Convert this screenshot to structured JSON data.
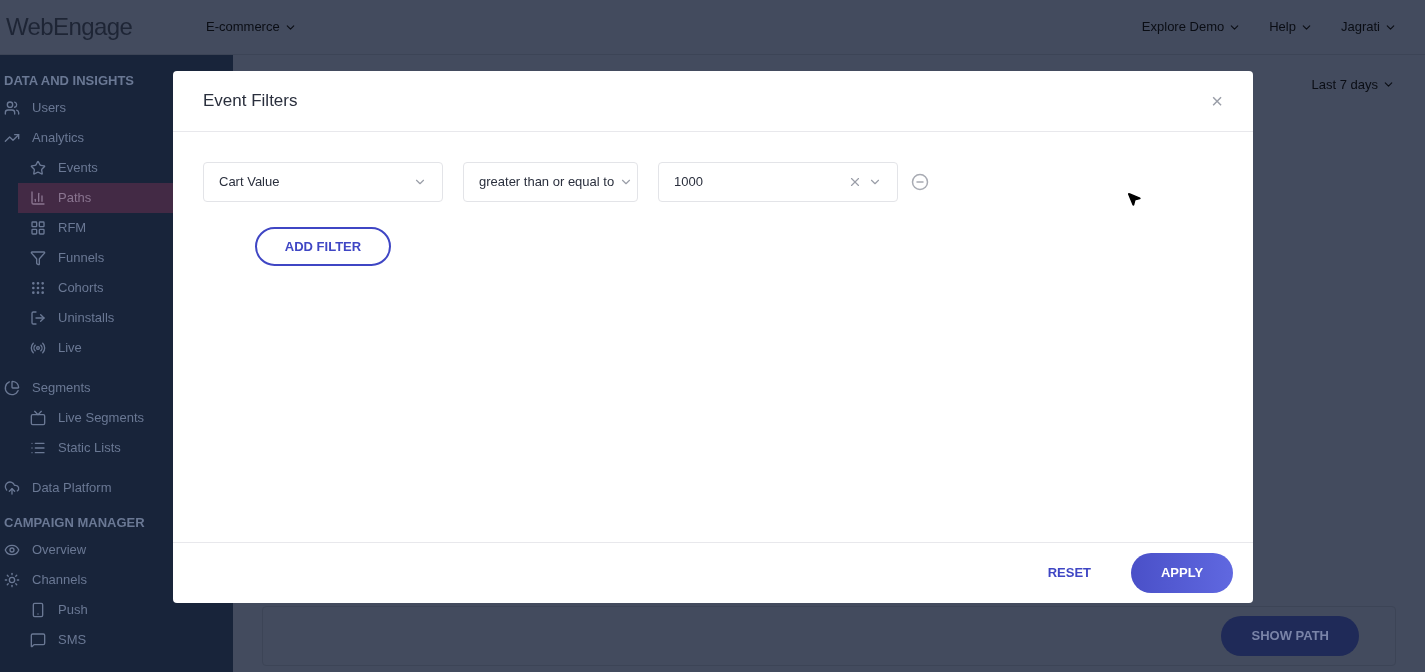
{
  "header": {
    "logo": "WebEngage",
    "project": "E-commerce",
    "menus": [
      "Explore Demo",
      "Help",
      "Jagrati"
    ]
  },
  "sidebar": {
    "sections": [
      {
        "title": "DATA AND INSIGHTS",
        "items": [
          {
            "label": "Users",
            "selected": false
          },
          {
            "label": "Analytics",
            "selected": false,
            "children": [
              {
                "label": "Events",
                "selected": false
              },
              {
                "label": "Paths",
                "selected": true
              },
              {
                "label": "RFM",
                "selected": false
              },
              {
                "label": "Funnels",
                "selected": false
              },
              {
                "label": "Cohorts",
                "selected": false
              },
              {
                "label": "Uninstalls",
                "selected": false
              },
              {
                "label": "Live",
                "selected": false
              }
            ]
          },
          {
            "label": "Segments",
            "selected": false,
            "children": [
              {
                "label": "Live Segments",
                "selected": false
              },
              {
                "label": "Static Lists",
                "selected": false
              }
            ]
          },
          {
            "label": "Data Platform",
            "selected": false
          }
        ]
      },
      {
        "title": "CAMPAIGN MANAGER",
        "items": [
          {
            "label": "Overview",
            "selected": false
          },
          {
            "label": "Channels",
            "selected": false,
            "children": [
              {
                "label": "Push",
                "selected": false
              },
              {
                "label": "SMS",
                "selected": false
              }
            ]
          }
        ]
      }
    ]
  },
  "main": {
    "date_range": "Last 7 days",
    "show_path_button": "SHOW PATH"
  },
  "modal": {
    "title": "Event Filters",
    "close": "×",
    "filters": [
      {
        "attribute": "Cart Value",
        "operator": "greater than or equal to",
        "value": "1000"
      }
    ],
    "add_filter": "ADD FILTER",
    "reset": "RESET",
    "apply": "APPLY"
  }
}
